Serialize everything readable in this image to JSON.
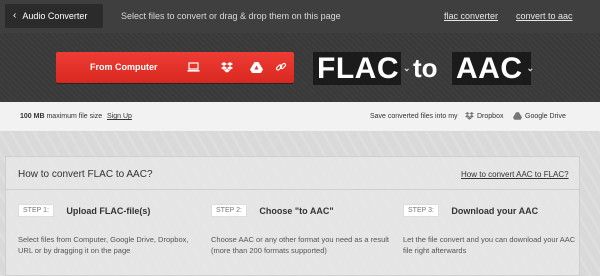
{
  "topbar": {
    "back_label": "Audio Converter",
    "message": "Select files to convert or drag & drop them on this page",
    "links": [
      "flac converter",
      "convert to aac"
    ]
  },
  "hero": {
    "from_button_label": "From Computer",
    "source_icons": [
      "laptop-icon",
      "dropbox-icon",
      "google-drive-icon",
      "link-icon"
    ],
    "from_format": "FLAC",
    "to_word": "to",
    "to_format": "AAC"
  },
  "strip": {
    "size_value": "100 MB",
    "size_text": "maximum file size",
    "signup": "Sign Up",
    "save_text": "Save converted files into my",
    "dropbox": "Dropbox",
    "gdrive": "Google Drive"
  },
  "howto": {
    "title": "How to convert FLAC to AAC?",
    "reverse_link": "How to convert AAC to FLAC?",
    "steps": [
      {
        "tag": "STEP 1:",
        "name": "Upload FLAC-file(s)",
        "desc": "Select files from Computer, Google Drive, Dropbox, URL or by dragging it on the page"
      },
      {
        "tag": "STEP 2:",
        "name": "Choose \"to AAC\"",
        "desc": "Choose AAC or any other format you need as a result (more than 200 formats supported)"
      },
      {
        "tag": "STEP 3:",
        "name": "Download your AAC",
        "desc": "Let the file convert and you can download your AAC file right afterwards"
      }
    ]
  },
  "colors": {
    "brand_red": "#e3302a",
    "topbar_bg": "#3f3f3f",
    "hero_bg": "#3a3a3a"
  }
}
